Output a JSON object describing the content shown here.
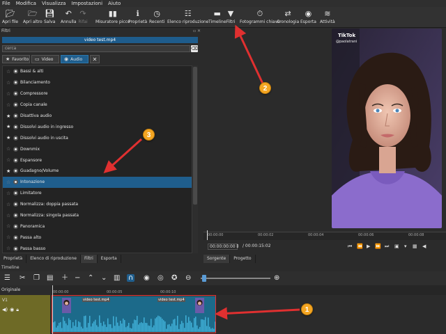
{
  "menu": [
    "File",
    "Modifica",
    "Visualizza",
    "Impostazioni",
    "Aiuto"
  ],
  "toolbar": [
    {
      "label": "Apri file",
      "icon": "folder-open-icon"
    },
    {
      "label": "Apri altro",
      "icon": "folder-arrow-icon"
    },
    {
      "label": "Salva",
      "icon": "save-icon"
    },
    {
      "label": "Annulla",
      "icon": "undo-icon"
    },
    {
      "label": "Rifai",
      "icon": "redo-icon"
    },
    {
      "label": "Misuratore picco",
      "icon": "peak-meter-icon"
    },
    {
      "label": "Proprietà",
      "icon": "info-icon"
    },
    {
      "label": "Recenti",
      "icon": "clock-icon"
    },
    {
      "label": "Elenco riproduzione",
      "icon": "playlist-icon"
    },
    {
      "label": "Timeline",
      "icon": "timeline-icon"
    },
    {
      "label": "Filtri",
      "icon": "filter-icon"
    },
    {
      "label": "Fotogrammi chiave",
      "icon": "stopwatch-icon"
    },
    {
      "label": "Cronologia",
      "icon": "history-icon"
    },
    {
      "label": "Esporta",
      "icon": "export-disc-icon"
    },
    {
      "label": "Attività",
      "icon": "jobs-icon"
    }
  ],
  "filters_panel": {
    "title": "Filtri",
    "file_name": "video test.mp4",
    "search_placeholder": "cerca",
    "tabs": [
      {
        "label": "Favorito",
        "icon": "star-icon",
        "active": false
      },
      {
        "label": "Video",
        "icon": "monitor-icon",
        "active": false
      },
      {
        "label": "Audio",
        "icon": "speaker-icon",
        "active": true
      }
    ],
    "close_label": "✕",
    "items": [
      {
        "label": "Bassi & alti",
        "fav": false,
        "selected": false
      },
      {
        "label": "Bilanciamento",
        "fav": false,
        "selected": false
      },
      {
        "label": "Compressore",
        "fav": false,
        "selected": false
      },
      {
        "label": "Copia canale",
        "fav": false,
        "selected": false
      },
      {
        "label": "Disattiva audio",
        "fav": true,
        "selected": false
      },
      {
        "label": "Dissolvi audio in ingresso",
        "fav": true,
        "selected": false
      },
      {
        "label": "Dissolvi audio in uscita",
        "fav": true,
        "selected": false
      },
      {
        "label": "Downmix",
        "fav": false,
        "selected": false
      },
      {
        "label": "Espansore",
        "fav": false,
        "selected": false
      },
      {
        "label": "Guadagno/Volume",
        "fav": true,
        "selected": false
      },
      {
        "label": "Intonazione",
        "fav": false,
        "selected": true
      },
      {
        "label": "Limitatore",
        "fav": false,
        "selected": false
      },
      {
        "label": "Normalizza: doppia passata",
        "fav": false,
        "selected": false
      },
      {
        "label": "Normalizza: singola passata",
        "fav": false,
        "selected": false
      },
      {
        "label": "Panoramica",
        "fav": false,
        "selected": false
      },
      {
        "label": "Passa alto",
        "fav": false,
        "selected": false
      },
      {
        "label": "Passa basso",
        "fav": false,
        "selected": false
      }
    ]
  },
  "left_bottom_tabs": [
    {
      "label": "Proprietà",
      "active": false
    },
    {
      "label": "Elenco di riproduzione",
      "active": false
    },
    {
      "label": "Filtri",
      "active": true
    },
    {
      "label": "Esporta",
      "active": false
    }
  ],
  "preview": {
    "overlay_logo": "TikTok",
    "overlay_user": "@paolatrani",
    "ruler_ticks": [
      "00:00:00",
      "00:00:02",
      "00:00:04",
      "00:00:06",
      "00:00:08"
    ],
    "current_timecode": "00:00:00:00",
    "total_timecode": "/ 00:00:15:02",
    "tabs": [
      {
        "label": "Sorgente",
        "active": true
      },
      {
        "label": "Progetto",
        "active": false
      }
    ]
  },
  "timeline": {
    "title": "Timeline",
    "track_original_label": "Originale",
    "track_v1_label": "V1",
    "ruler_ticks": [
      "00:00:00",
      "00:00:05",
      "00:00:10"
    ],
    "clip_labels": [
      "video test.mp4",
      "video test.mp4"
    ]
  },
  "annotations": [
    "1",
    "2",
    "3"
  ],
  "colors": {
    "accent": "#1f5e8d",
    "badge": "#f4a623",
    "arrow": "#e03030",
    "track_header": "#6e6a26",
    "clip": "#1c6a8a",
    "video_tint": "#8a6ad0"
  }
}
